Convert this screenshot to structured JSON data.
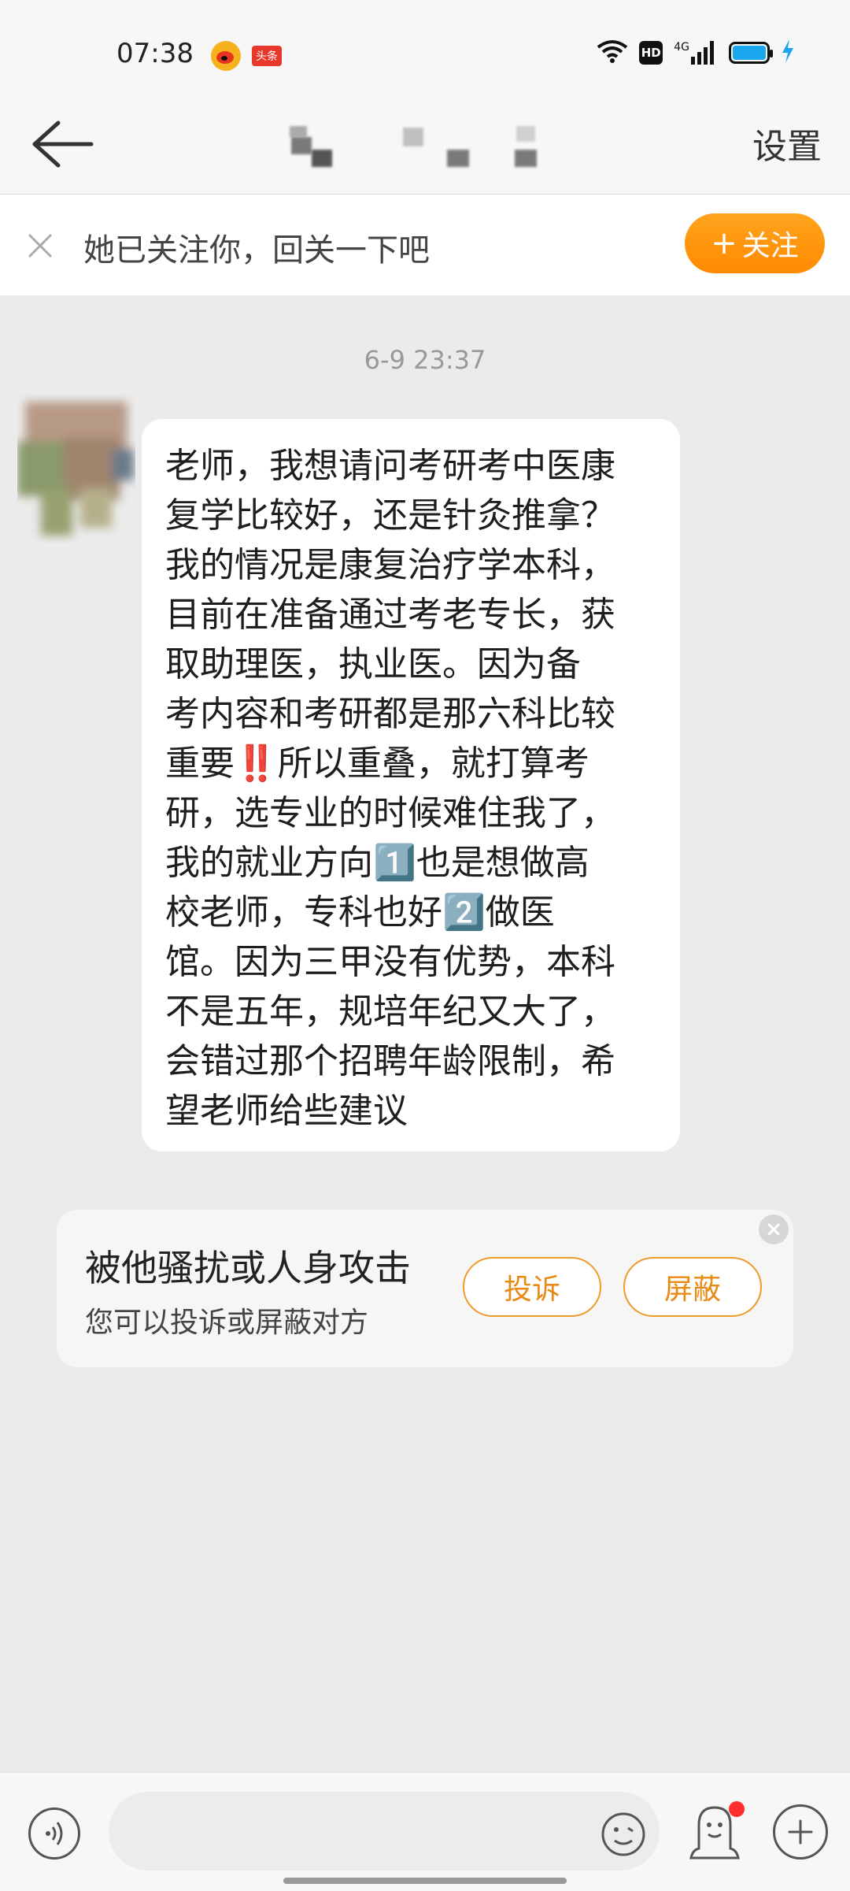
{
  "status_bar": {
    "time": "07:38",
    "toutiao_label": "头条",
    "hd_label": "HD",
    "network_label": "4G",
    "icons": [
      "weibo-icon",
      "toutiao-icon",
      "wifi-icon",
      "hd-icon",
      "signal-icon",
      "battery-icon",
      "charging-icon"
    ]
  },
  "header": {
    "settings_label": "设置"
  },
  "follow_banner": {
    "text": "她已关注你，回关一下吧",
    "follow_label": "关注",
    "follow_plus": "+"
  },
  "chat": {
    "timestamp": "6-9 23:37",
    "message": "老师，我想请问考研考中医康\n复学比较好，还是针灸推拿？\n我的情况是康复治疗学本科，\n目前在准备通过考老专长，获\n取助理医，执业医。因为备\n考内容和考研都是那六科比较\n重要‼️所以重叠，就打算考\n研，选专业的时候难住我了，\n我的就业方向1️⃣也是想做高\n校老师，专科也好2️⃣做医\n馆。因为三甲没有优势，本科\n不是五年，规培年纪又大了，\n会错过那个招聘年龄限制，希\n望老师给些建议"
  },
  "report_card": {
    "title": "被他骚扰或人身攻击",
    "subtitle": "您可以投诉或屏蔽对方",
    "report_label": "投诉",
    "block_label": "屏蔽"
  },
  "input_bar": {
    "placeholder": ""
  },
  "colors": {
    "accent_orange": "#ff9a0f",
    "notification_red": "#ff2e2e",
    "background": "#ebebeb"
  }
}
